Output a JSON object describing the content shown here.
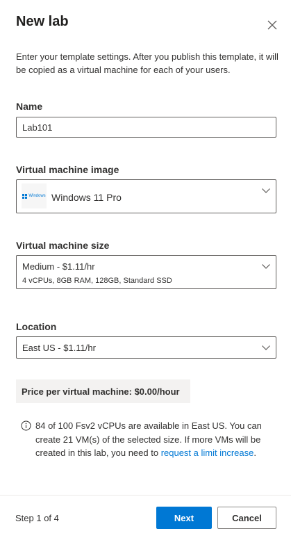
{
  "panel": {
    "title": "New lab",
    "description": "Enter your template settings. After you publish this template, it will be copied as a virtual machine for each of your users."
  },
  "name_field": {
    "label": "Name",
    "value": "Lab101"
  },
  "vm_image": {
    "label": "Virtual machine image",
    "selected": "Windows 11 Pro",
    "logo_text": "Windows"
  },
  "vm_size": {
    "label": "Virtual machine size",
    "selected": "Medium - $1.11/hr",
    "detail": "4 vCPUs, 8GB RAM, 128GB, Standard SSD"
  },
  "location": {
    "label": "Location",
    "selected": "East US - $1.11/hr"
  },
  "price": {
    "text": "Price per virtual machine: $0.00/hour"
  },
  "quota_info": {
    "text": "84 of 100 Fsv2 vCPUs are available in East US. You can create 21 VM(s) of the selected size. If more VMs will be created in this lab, you need to ",
    "link_text": "request a limit increase",
    "suffix": "."
  },
  "footer": {
    "step": "Step 1 of 4",
    "next_label": "Next",
    "cancel_label": "Cancel"
  },
  "colors": {
    "accent": "#0078d4",
    "border": "#605e5c",
    "price_bg": "#f3f2f1"
  },
  "icons": [
    "close-icon",
    "chevron-down-icon",
    "windows-logo-icon",
    "info-icon"
  ]
}
